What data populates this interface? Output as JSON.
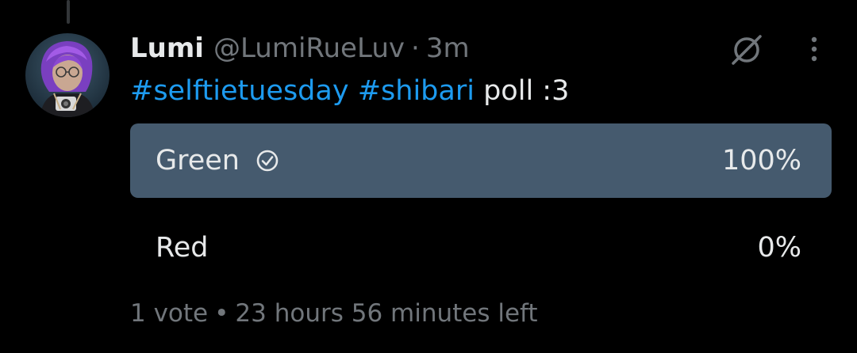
{
  "author": {
    "display_name": "Lumi",
    "handle": "@LumiRueLuv",
    "separator": "·",
    "timestamp": "3m"
  },
  "tweet": {
    "hashtags": [
      "#selftietuesday",
      "#shibari"
    ],
    "text": "poll :3"
  },
  "icons": {
    "grok": "grok-icon",
    "more": "more-options-icon",
    "voted": "check-circle-icon"
  },
  "poll": {
    "options": [
      {
        "label": "Green",
        "percent": "100%",
        "fraction": 1.0,
        "selected": true
      },
      {
        "label": "Red",
        "percent": "0%",
        "fraction": 0.0,
        "selected": false
      }
    ],
    "votes": "1 vote",
    "separator": "•",
    "time_left": "23 hours 56 minutes left"
  },
  "colors": {
    "background": "#000000",
    "hashtag": "#1d9bf0",
    "poll_fill": "#455a6e",
    "secondary_text": "#71767b",
    "primary_text": "#e7e9ea"
  }
}
